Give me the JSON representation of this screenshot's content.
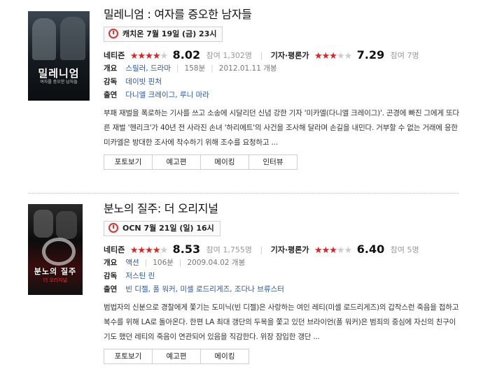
{
  "movies": [
    {
      "title": "밀레니엄 : 여자를 증오한 남자들",
      "poster_title": "밀레니엄",
      "poster_subtitle": "여자를 증오한 남자들",
      "airtime": "캐치온 7월 19일 (금) 23시",
      "netizen_label": "네티즌",
      "netizen_stars": "★★★★",
      "netizen_stars_empty": "★",
      "netizen_score": "8.02",
      "netizen_count": "참여 1,302명",
      "critic_label": "기자·평론가",
      "critic_stars": "★★★",
      "critic_stars_empty": "★★",
      "critic_score": "7.29",
      "critic_count": "참여 7명",
      "genre_label": "개요",
      "genre": "스릴러, 드라마",
      "runtime": "158분",
      "release": "2012.01.11 개봉",
      "director_label": "감독",
      "director": "데이빗 핀처",
      "cast_label": "출연",
      "cast": "다니엘 크레이그, 루니 마라",
      "description": "부패 재벌을 폭로하는 기사를 쓰고 소송에 시달리던 신념 강한 기자 '미카엘(다니엘 크레이그)'. 곤경에 빠진 그에게 또다른 재벌 '헨리크'가 40년 전 사라진 손녀 '하리에트'의 사건을 조사해 달라며 손길을 내민다. 거부할 수 없는 거래에 응한 미카엘은 방대한 조사에 착수하기 위해 조수를 요청하고 ...",
      "buttons": [
        "포토보기",
        "예고편",
        "메이킹",
        "인터뷰"
      ]
    },
    {
      "title": "분노의 질주: 더 오리지널",
      "poster_title": "분노의 질주",
      "poster_subtitle": "더 오리지널",
      "airtime": "OCN 7월 21일 (일) 16시",
      "netizen_label": "네티즌",
      "netizen_stars": "★★★★",
      "netizen_stars_empty": "★",
      "netizen_score": "8.53",
      "netizen_count": "참여 1,755명",
      "critic_label": "기자·평론가",
      "critic_stars": "★★★",
      "critic_stars_empty": "★★",
      "critic_score": "6.40",
      "critic_count": "참여 5명",
      "genre_label": "개요",
      "genre": "액션",
      "runtime": "106분",
      "release": "2009.04.02 개봉",
      "director_label": "감독",
      "director": "저스틴 린",
      "cast_label": "출연",
      "cast": "빈 디젤, 폴 워커, 미셸 로드리게즈, 조다나 브류스터",
      "description": "범법자의 신분으로 경찰에게 쫓기는 도미닉(빈 디젤)은 사랑하는 여인 레티(미셸 로드리게즈)의 갑작스런 죽음을 접하고 복수를 위해 LA로 돌아온다. 한편 LA 최대 갱단의 두목을 쫓고 있던 브라이언(폴 워커)은 범죄의 중심에 자신의 친구이기도 했던 레티의 죽음이 연관되어 있음을 직감한다. 위장 잠입한 갱단 ...",
      "buttons": [
        "포토보기",
        "예고편",
        "메이킹"
      ]
    }
  ]
}
